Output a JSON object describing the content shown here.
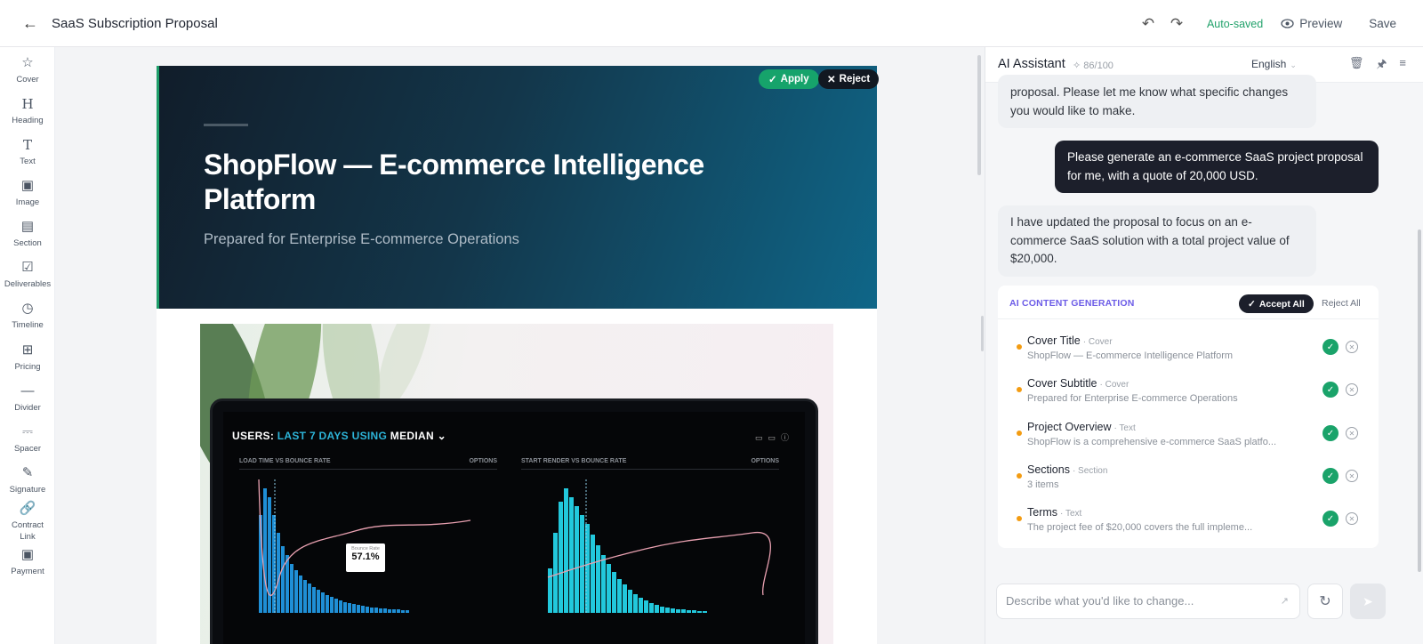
{
  "header": {
    "title": "SaaS Subscription Proposal",
    "autosaved": "Auto-saved",
    "preview": "Preview",
    "save": "Save"
  },
  "toolbar": {
    "items": [
      {
        "label": "Cover",
        "icon": "star-icon"
      },
      {
        "label": "Heading",
        "icon": "heading-icon"
      },
      {
        "label": "Text",
        "icon": "text-icon"
      },
      {
        "label": "Image",
        "icon": "image-icon"
      },
      {
        "label": "Section",
        "icon": "section-icon"
      },
      {
        "label": "Deliverables",
        "icon": "checkbox-icon"
      },
      {
        "label": "Timeline",
        "icon": "clock-icon"
      },
      {
        "label": "Pricing",
        "icon": "table-icon"
      },
      {
        "label": "Divider",
        "icon": "divider-icon"
      },
      {
        "label": "Spacer",
        "icon": "spacer-icon"
      },
      {
        "label": "Signature",
        "icon": "pen-icon"
      },
      {
        "label": "Contract Link",
        "icon": "link-icon"
      },
      {
        "label": "Payment",
        "icon": "payment-icon"
      }
    ]
  },
  "cover": {
    "title": "ShopFlow — E-commerce Intelligence Platform",
    "subtitle": "Prepared for Enterprise E-commerce Operations",
    "apply": "Apply",
    "reject": "Reject"
  },
  "photo_screen": {
    "heading_prefix": "USERS:",
    "heading_highlight": "LAST 7 DAYS",
    "heading_mid": "USING",
    "heading_suffix": "MEDIAN",
    "panel_left_title": "LOAD TIME VS BOUNCE RATE",
    "panel_right_title": "START RENDER VS BOUNCE RATE",
    "options": "OPTIONS",
    "tooltip_label": "Bounce Rate",
    "tooltip_value": "57.1%"
  },
  "ai": {
    "title": "AI Assistant",
    "quota": "86/100",
    "language": "English",
    "msg1": "proposal. Please let me know what specific changes you would like to make.",
    "user_msg": "Please generate an e-commerce SaaS project proposal for me, with a quote of 20,000 USD.",
    "msg2": "I have updated the proposal to focus on an e-commerce SaaS solution with a total project value of $20,000.",
    "gen": {
      "title": "AI CONTENT GENERATION",
      "accept_all": "Accept All",
      "reject_all": "Reject All",
      "items": [
        {
          "name": "Cover Title",
          "type": "· Cover",
          "value": "ShopFlow — E-commerce Intelligence Platform"
        },
        {
          "name": "Cover Subtitle",
          "type": "· Cover",
          "value": "Prepared for Enterprise E-commerce Operations"
        },
        {
          "name": "Project Overview",
          "type": "· Text",
          "value": "ShopFlow is a comprehensive e-commerce SaaS platfo..."
        },
        {
          "name": "Sections",
          "type": "· Section",
          "value": "3 items"
        },
        {
          "name": "Terms",
          "type": "· Text",
          "value": "The project fee of $20,000 covers the full impleme..."
        }
      ]
    },
    "input_placeholder": "Describe what you'd like to change..."
  },
  "colors": {
    "accent_green": "#1aa36a",
    "accent_purple": "#6c5ce7",
    "dark": "#1c1f2b",
    "pending_dot": "#f39c12"
  }
}
